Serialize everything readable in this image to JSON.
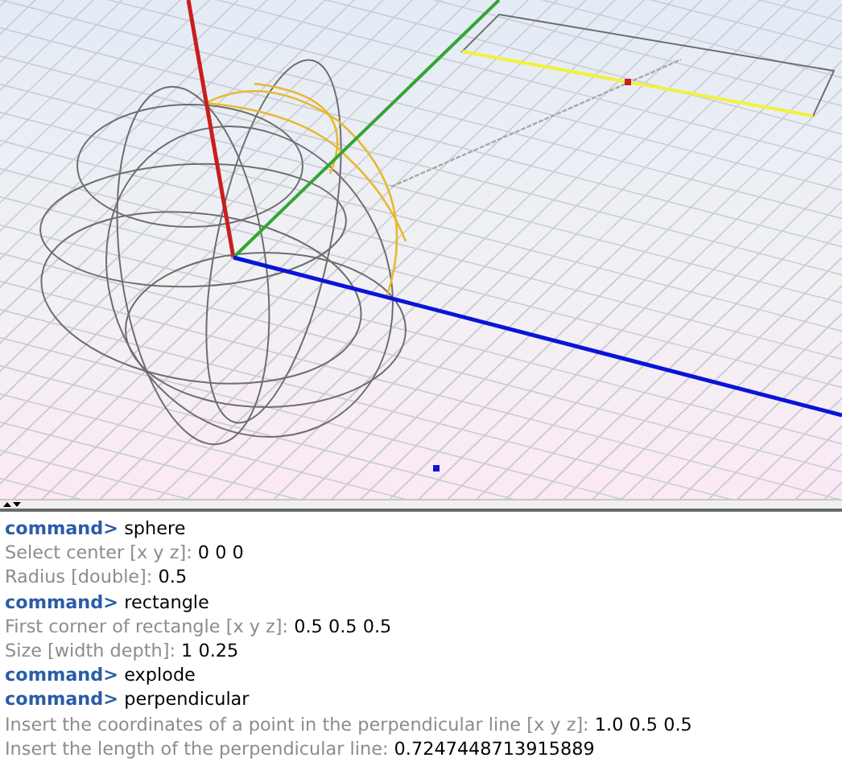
{
  "viewport": {
    "kind": "scene"
  },
  "console": {
    "lines": [
      {
        "kind": "command",
        "prompt": "command>",
        "text": "sphere"
      },
      {
        "kind": "prompt",
        "label": "Select center [x y z]:",
        "value": "0 0 0"
      },
      {
        "kind": "prompt",
        "label": "Radius [double]:",
        "value": "0.5"
      },
      {
        "kind": "command",
        "prompt": "command>",
        "text": "rectangle"
      },
      {
        "kind": "prompt",
        "label": "First corner of rectangle [x y z]:",
        "value": "0.5 0.5 0.5"
      },
      {
        "kind": "prompt",
        "label": "Size [width depth]:",
        "value": "1 0.25"
      },
      {
        "kind": "command",
        "prompt": "command>",
        "text": "explode"
      },
      {
        "kind": "command",
        "prompt": "command>",
        "text": "perpendicular"
      },
      {
        "kind": "prompt",
        "label": "Insert the coordinates of a point in the perpendicular line [x y z]:",
        "value": "1.0 0.5 0.5"
      },
      {
        "kind": "prompt",
        "label": "Insert the length of the perpendicular line:",
        "value": "0.7247448713915889"
      }
    ]
  }
}
